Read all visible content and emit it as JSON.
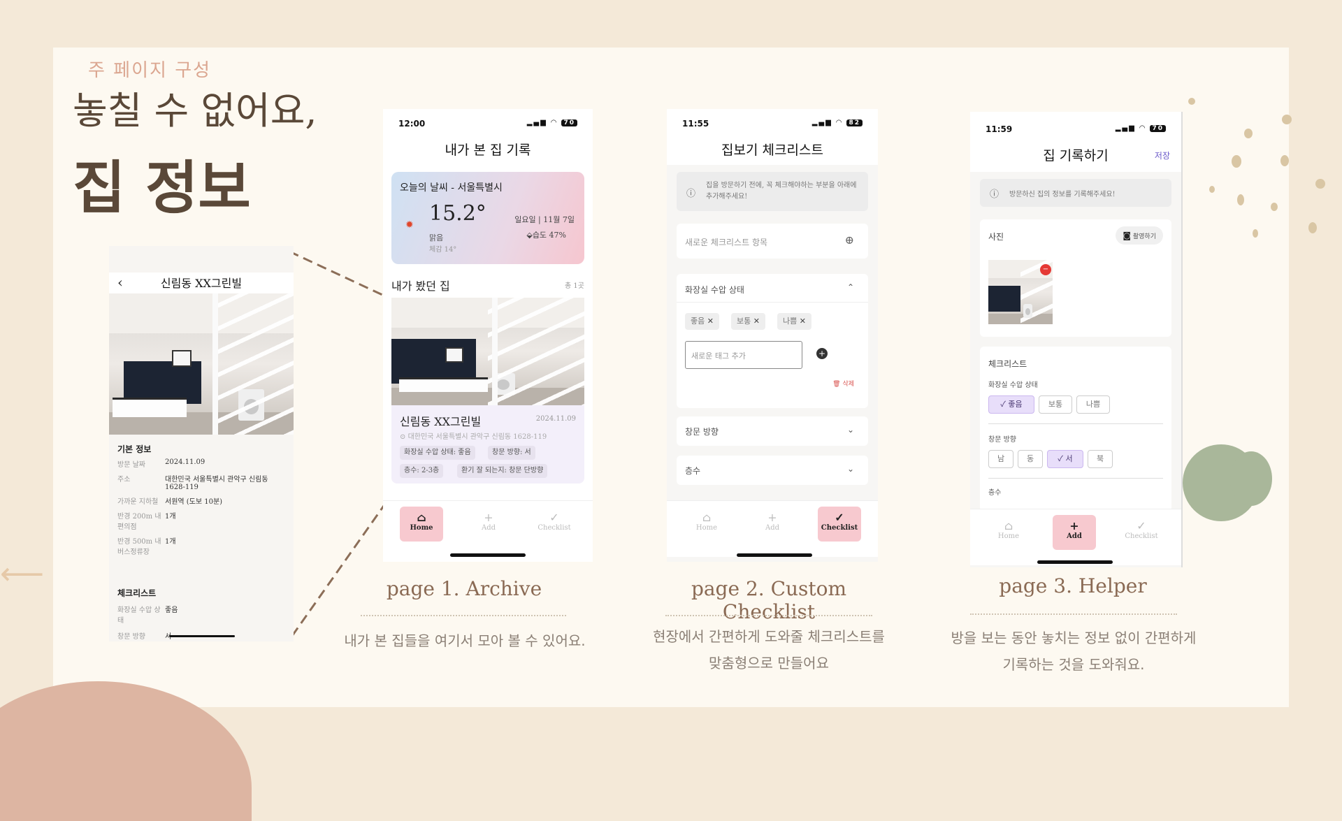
{
  "section_label": "주 페이지 구성",
  "headline": {
    "line1": "놓칠 수 없어요,",
    "line2": "집 정보"
  },
  "detail_screen": {
    "title": "신림동 XX그린빌",
    "basic_info_title": "기본 정보",
    "info_rows": [
      {
        "label": "방문 날짜",
        "value": "2024.11.09"
      },
      {
        "label": "주소",
        "value": "대한민국 서울특별시 관악구 신림동 1628-119"
      },
      {
        "label": "가까운 지하철",
        "value": "서원역 (도보 10분)"
      },
      {
        "label": "반경 200m 내 편의점",
        "value": "1개"
      },
      {
        "label": "반경 500m 내 버스정류장",
        "value": "1개"
      }
    ],
    "checklist_title": "체크리스트",
    "checklist_rows": [
      {
        "label": "화장실 수압 상태",
        "value": "좋음"
      },
      {
        "label": "창문 방향",
        "value": "서"
      }
    ]
  },
  "archive_screen": {
    "time": "12:00",
    "battery": "70",
    "title": "내가 본 집 기록",
    "weather": {
      "heading": "오늘의 날씨 - 서울특별시",
      "temp": "15.2°",
      "date": "일요일 | 11월 7일",
      "condition": "맑음",
      "feels": "체감 14°",
      "humidity": "습도 47%"
    },
    "list_title": "내가 봤던 집",
    "count": "총 1곳",
    "house": {
      "name": "신림동 XX그린빌",
      "date": "2024.11.09",
      "address": "대한민국 서울특별시 관악구 신림동 1628-119",
      "tags": [
        "화장실 수압 상태: 좋음",
        "창문 방향: 서",
        "층수: 2-3층",
        "환기 잘 되는지: 창문 단방향"
      ]
    },
    "tabs": [
      "Home",
      "Add",
      "Checklist"
    ]
  },
  "checklist_screen": {
    "time": "11:55",
    "battery": "82",
    "title": "집보기 체크리스트",
    "info": "집을 방문하기 전에, 꼭 체크해야하는 부분을 아래에 추가해주세요!",
    "new_item_placeholder": "새로운 체크리스트 항목",
    "section_title": "화장실 수압 상태",
    "tags": [
      "좋음",
      "보통",
      "나쁨"
    ],
    "new_tag_placeholder": "새로운 태그 추가",
    "delete_label": "삭제",
    "collapsed_items": [
      "창문 방향",
      "층수"
    ],
    "tabs": [
      "Home",
      "Add",
      "Checklist"
    ]
  },
  "helper_screen": {
    "time": "11:59",
    "battery": "70",
    "title": "집 기록하기",
    "save_label": "저장",
    "info": "방문하신 집의 정보를 기록해주세요!",
    "photo_label": "사진",
    "camera_label": "촬영하기",
    "checklist_label": "체크리스트",
    "q1": "화장실 수압 상태",
    "q1_options": [
      "좋음",
      "보통",
      "나쁨"
    ],
    "q2": "창문 방향",
    "q2_options": [
      "남",
      "동",
      "서",
      "북"
    ],
    "q3": "층수",
    "tabs": [
      "Home",
      "Add",
      "Checklist"
    ]
  },
  "captions": [
    {
      "title": "page 1. Archive",
      "desc": "내가 본 집들을 여기서 모아 볼 수 있어요."
    },
    {
      "title": "page 2. Custom Checklist",
      "desc1": "현장에서 간편하게 도와줄 체크리스트를",
      "desc2": "맞춤형으로 만들어요"
    },
    {
      "title": "page 3. Helper",
      "desc1": "방을 보는 동안 놓치는 정보 없이 간편하게",
      "desc2": "기록하는 것을 도와줘요."
    }
  ]
}
